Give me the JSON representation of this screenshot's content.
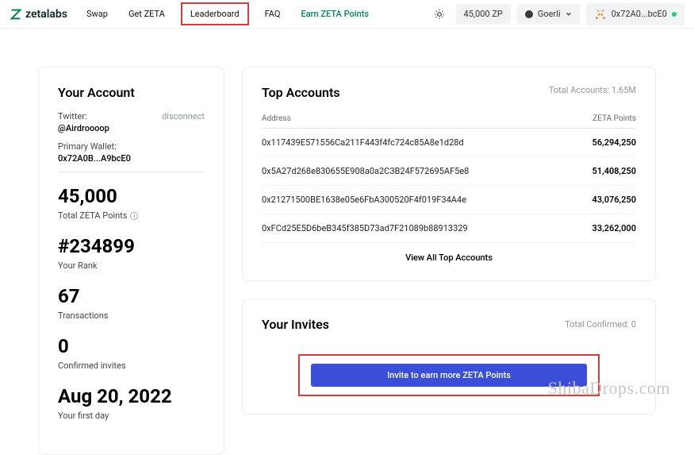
{
  "brand": "zetalabs",
  "nav": {
    "swap": "Swap",
    "get_zeta": "Get ZETA",
    "leaderboard": "Leaderboard",
    "faq": "FAQ",
    "earn": "Earn ZETA Points"
  },
  "topright": {
    "points": "45,000 ZP",
    "network": "Goerli",
    "wallet": "0x72A0...bcE0"
  },
  "account": {
    "title": "Your Account",
    "twitter_label": "Twitter:",
    "twitter_handle": "@Airdroooop",
    "disconnect": "disconnect",
    "wallet_label": "Primary Wallet:",
    "wallet_address": "0x72A0B...A9bcE0",
    "points_value": "45,000",
    "points_label": "Total ZETA Points",
    "rank_value": "#234899",
    "rank_label": "Your Rank",
    "tx_value": "67",
    "tx_label": "Transactions",
    "invites_value": "0",
    "invites_label": "Confirmed invites",
    "firstday_value": "Aug 20, 2022",
    "firstday_label": "Your first day"
  },
  "top_accounts": {
    "title": "Top Accounts",
    "total_label": "Total Accounts: 1.65M",
    "col_address": "Address",
    "col_points": "ZETA Points",
    "rows": [
      {
        "addr": "0x117439E571556Ca211F443f4fc724c85A8e1d28d",
        "pts": "56,294,250"
      },
      {
        "addr": "0x5A27d268e830655E908a0a2C3B24F572695AF5e8",
        "pts": "51,408,250"
      },
      {
        "addr": "0x21271500BE1638e05e6FbA300520F4f019F34A4e",
        "pts": "43,076,250"
      },
      {
        "addr": "0xFCd25E5D6beB345f385D73ad7F21089b88913329",
        "pts": "33,262,000"
      }
    ],
    "view_all": "View All Top Accounts"
  },
  "invites": {
    "title": "Your Invites",
    "confirmed": "Total Confirmed: 0",
    "button": "Invite to earn more ZETA Points"
  },
  "watermark": "ShibaDrops.com"
}
